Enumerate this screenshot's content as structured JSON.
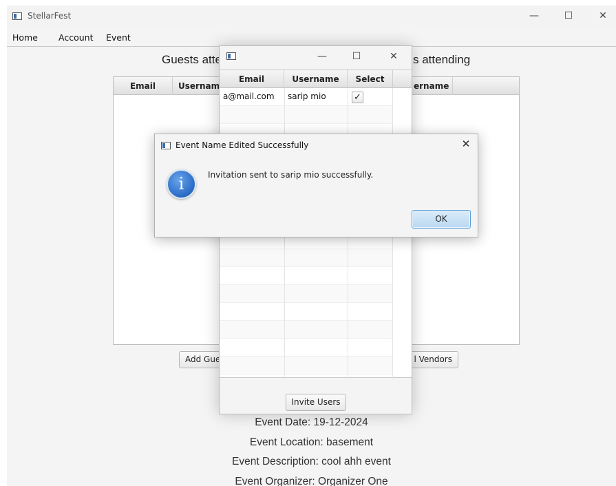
{
  "main_window": {
    "title": "StellarFest",
    "controls": {
      "minimize": "—",
      "maximize": "☐",
      "close": "✕"
    },
    "menu": [
      "Home",
      "Account",
      "Event"
    ],
    "guests_heading": "Guests atte",
    "vendors_heading": "s attending",
    "guests_table": {
      "columns": [
        "Email",
        "Usernam"
      ]
    },
    "vendors_table": {
      "columns": [
        "ername"
      ]
    },
    "add_guests_button": "Add Gue",
    "add_vendors_button": "l Vendors",
    "event_date": "Event Date: 19-12-2024",
    "event_location": "Event Location: basement",
    "event_description": "Event Description: cool ahh event",
    "event_organizer": "Event Organizer: Organizer One"
  },
  "invite_window": {
    "controls": {
      "minimize": "—",
      "maximize": "☐",
      "close": "✕"
    },
    "columns": [
      "Email",
      "Username",
      "Select"
    ],
    "rows": [
      {
        "email": "a@mail.com",
        "username": "sarip mio",
        "selected": true
      }
    ],
    "invite_button": "Invite Users"
  },
  "dialog": {
    "title": "Event Name Edited Successfully",
    "close": "✕",
    "message": "Invitation sent to sarip mio successfully.",
    "ok_button": "OK",
    "icon": "info-icon",
    "icon_glyph": "i"
  },
  "colors": {
    "accent": "#2d6ec8",
    "ok_button_border": "#5aa0d8"
  }
}
